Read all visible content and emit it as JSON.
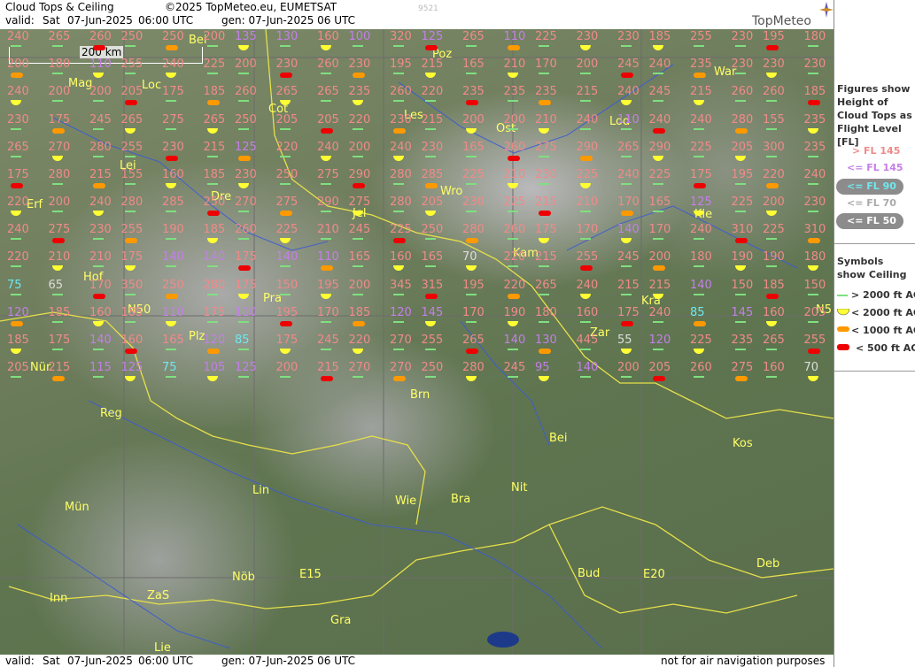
{
  "header": {
    "title": "Cloud Tops & Ceiling",
    "copyright": "©2025 TopMeteo.eu, EUMETSAT",
    "valid_label": "valid:",
    "valid_day": "Sat",
    "valid_date": "07-Jun-2025",
    "valid_time": "06:00 UTC",
    "gen_text": "gen: 07-Jun-2025 06 UTC",
    "code": "9521",
    "logo_text": "TopMeteo"
  },
  "footer": {
    "valid_label": "valid:",
    "valid_day": "Sat",
    "valid_date": "07-Jun-2025",
    "valid_time": "06:00 UTC",
    "gen_text": "gen: 07-Jun-2025 06 UTC",
    "disclaimer": "not for air navigation purposes"
  },
  "scale": {
    "label": "200 km"
  },
  "legend": {
    "figures_title": "Figures show Height of Cloud Tops as Flight Level [FL]",
    "fl_items": [
      {
        "text": "> FL 145",
        "color": "#f08a8a"
      },
      {
        "text": "<= FL 145",
        "color": "#c47fe8"
      },
      {
        "text": "<= FL 90",
        "color": "#6ee8ef"
      },
      {
        "text": "<= FL 70",
        "color": "#dddddd"
      },
      {
        "text": "<= FL 50",
        "color": "#ffffff"
      }
    ],
    "symbols_title": "Symbols show Ceiling",
    "ceiling_items": [
      {
        "text": "> 2000 ft AGL",
        "symbol": "green-line",
        "color": "#7fe07f"
      },
      {
        "text": "< 2000 ft AGL",
        "symbol": "yellow-half-disc",
        "color": "#ffff33"
      },
      {
        "text": "< 1000 ft AGL",
        "symbol": "orange-bar",
        "color": "#ff9900"
      },
      {
        "text": "< 500 ft AGL",
        "symbol": "red-bar",
        "color": "#ee0000"
      }
    ]
  },
  "colors": {
    "high": "#f08a8a",
    "mid": "#c47fe8",
    "low": "#6ee8ef",
    "vlow": "#dddddd",
    "vvlow": "#ffffff",
    "city": "#ffff66",
    "ceiling_ok": "#7fe07f"
  },
  "cities": [
    {
      "name": "Bei"
    },
    {
      "name": "Poz"
    },
    {
      "name": "War"
    },
    {
      "name": "Mag"
    },
    {
      "name": "Loc"
    },
    {
      "name": "Cot"
    },
    {
      "name": "Les"
    },
    {
      "name": "Ost"
    },
    {
      "name": "Lod"
    },
    {
      "name": "Lei"
    },
    {
      "name": "Dre"
    },
    {
      "name": "Erf"
    },
    {
      "name": "Jel"
    },
    {
      "name": "Wro"
    },
    {
      "name": "Kie"
    },
    {
      "name": "Kam"
    },
    {
      "name": "Hof"
    },
    {
      "name": "Pra"
    },
    {
      "name": "Kra"
    },
    {
      "name": "N50"
    },
    {
      "name": "Plz"
    },
    {
      "name": "Zar"
    },
    {
      "name": "N5"
    },
    {
      "name": "Nür"
    },
    {
      "name": "Brn"
    },
    {
      "name": "Reg"
    },
    {
      "name": "Bei"
    },
    {
      "name": "Kos"
    },
    {
      "name": "Lin"
    },
    {
      "name": "Nit"
    },
    {
      "name": "Mün"
    },
    {
      "name": "Wie"
    },
    {
      "name": "Bra"
    },
    {
      "name": "Deb"
    },
    {
      "name": "Bud"
    },
    {
      "name": "Nöb"
    },
    {
      "name": "E15"
    },
    {
      "name": "E20"
    },
    {
      "name": "Inn"
    },
    {
      "name": "ZaS"
    },
    {
      "name": "Gra"
    },
    {
      "name": "Lie"
    }
  ],
  "values": [
    "240",
    "265",
    "260",
    "250",
    "250",
    "200",
    "135",
    "130",
    "160",
    "100",
    "320",
    "125",
    "265",
    "110",
    "225",
    "230",
    "230",
    "185",
    "255",
    "230",
    "195",
    "180",
    "200",
    "180",
    "110",
    "255",
    "240",
    "225",
    "200",
    "230",
    "260",
    "230",
    "195",
    "215",
    "165",
    "210",
    "170",
    "200",
    "245",
    "240",
    "235",
    "230",
    "230",
    "230",
    "240",
    "200",
    "200",
    "205",
    "175",
    "185",
    "260",
    "265",
    "265",
    "235",
    "260",
    "220",
    "235",
    "235",
    "235",
    "215",
    "240",
    "245",
    "215",
    "260",
    "260",
    "185",
    "230",
    "175",
    "245",
    "265",
    "275",
    "265",
    "250",
    "205",
    "205",
    "220",
    "230",
    "215",
    "200",
    "200",
    "210",
    "240",
    "110",
    "240",
    "240",
    "280",
    "155",
    "235",
    "265",
    "270",
    "280",
    "255",
    "230",
    "215",
    "125",
    "220",
    "240",
    "200",
    "240",
    "230",
    "165",
    "260",
    "275",
    "290",
    "265",
    "290",
    "225",
    "205",
    "300",
    "235",
    "175",
    "280",
    "215",
    "155",
    "160",
    "185",
    "230",
    "250",
    "275",
    "290",
    "280",
    "285",
    "225",
    "210",
    "230",
    "225",
    "240",
    "225",
    "175",
    "195",
    "220",
    "240",
    "220",
    "200",
    "240",
    "280",
    "285",
    "250",
    "270",
    "275",
    "290",
    "275",
    "280",
    "205",
    "230",
    "225",
    "215",
    "210",
    "170",
    "165",
    "125",
    "225",
    "200",
    "230",
    "240",
    "275",
    "230",
    "255",
    "190",
    "185",
    "260",
    "225",
    "210",
    "245",
    "225",
    "250",
    "280",
    "260",
    "175",
    "170",
    "140",
    "170",
    "240",
    "310",
    "225",
    "310",
    "220",
    "210",
    "210",
    "175",
    "140",
    "140",
    "175",
    "140",
    "110",
    "165",
    "160",
    "165",
    "70",
    "220",
    "215",
    "255",
    "245",
    "200",
    "180",
    "190",
    "190",
    "180",
    "75",
    "65",
    "170",
    "350",
    "250",
    "280",
    "175",
    "150",
    "195",
    "200",
    "345",
    "315",
    "195",
    "220",
    "265",
    "240",
    "215",
    "215",
    "140",
    "150",
    "185",
    "150",
    "120",
    "185",
    "160",
    "185",
    "110",
    "175",
    "110",
    "195",
    "170",
    "185",
    "120",
    "145",
    "170",
    "190",
    "180",
    "160",
    "175",
    "240",
    "85",
    "145",
    "160",
    "205",
    "185",
    "175",
    "140",
    "160",
    "165",
    "120",
    "85",
    "175",
    "245",
    "220",
    "270",
    "255",
    "265",
    "140",
    "130",
    "445",
    "55",
    "120",
    "225",
    "235",
    "265",
    "255",
    "205",
    "215",
    "115",
    "125",
    "75",
    "105",
    "125",
    "200",
    "215",
    "270",
    "270",
    "250",
    "280",
    "245",
    "95",
    "140",
    "200",
    "205",
    "260",
    "275",
    "160",
    "70"
  ]
}
